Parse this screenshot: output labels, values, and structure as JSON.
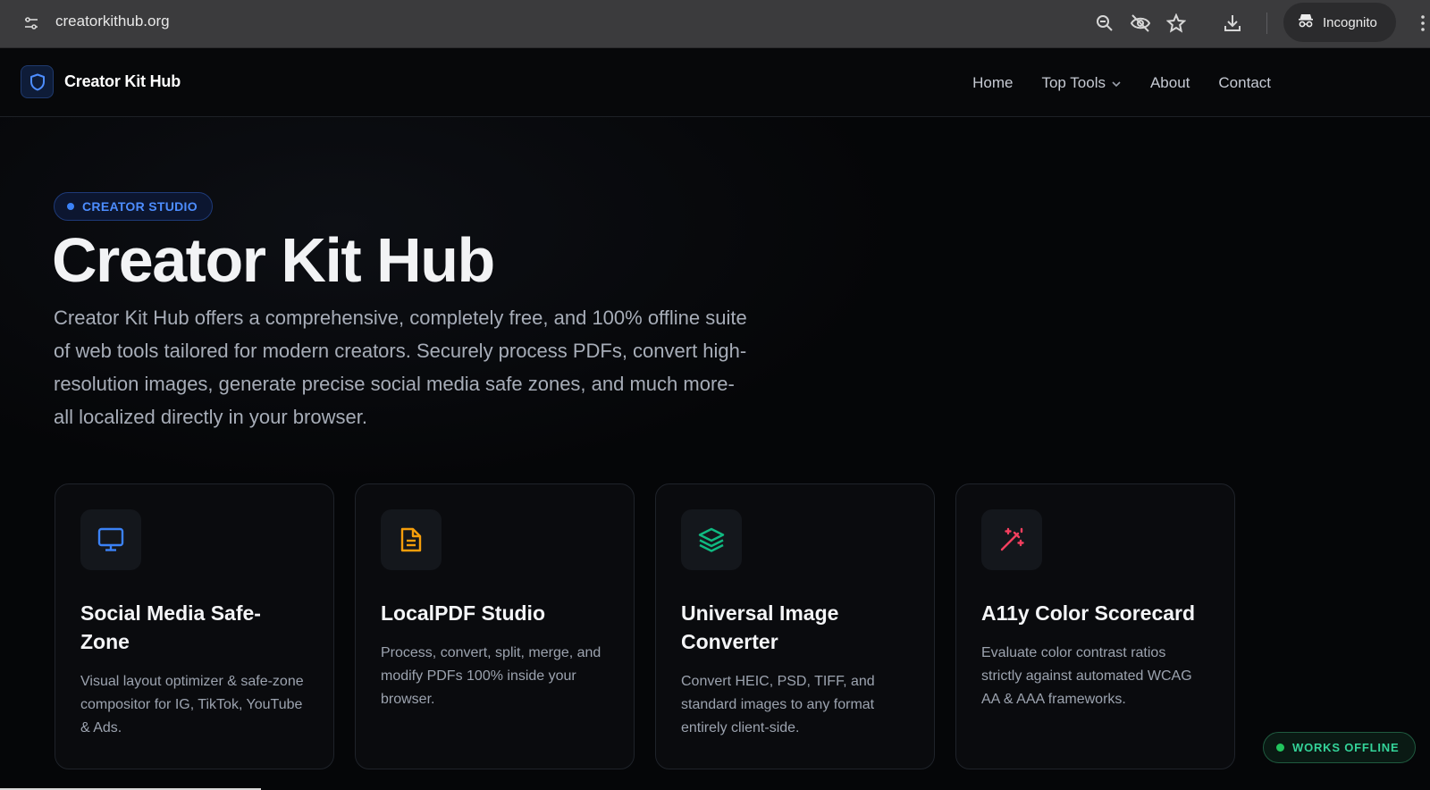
{
  "browser": {
    "url": "creatorkithub.org",
    "incognito_label": "Incognito",
    "icons": [
      "site-info-icon",
      "zoom-icon",
      "eye-off-icon",
      "star-icon",
      "download-icon",
      "incognito-icon",
      "menu-icon"
    ]
  },
  "nav": {
    "brand": "Creator Kit Hub",
    "links": [
      "Home",
      "Top Tools",
      "About",
      "Contact"
    ]
  },
  "hero": {
    "badge": "CREATOR STUDIO",
    "title": "Creator Kit Hub",
    "description": "Creator Kit Hub offers a comprehensive, completely free, and 100% offline suite of web tools tailored for modern creators. Securely process PDFs, convert high-resolution images, generate precise social media safe zones, and much more-all localized directly in your browser."
  },
  "cards": [
    {
      "title": "Social Media Safe-Zone",
      "description": "Visual layout optimizer & safe-zone compositor for IG, TikTok, YouTube & Ads.",
      "icon": "monitor-icon",
      "color": "#3b82f6"
    },
    {
      "title": "LocalPDF Studio",
      "description": "Process, convert, split, merge, and modify PDFs 100% inside your browser.",
      "icon": "document-icon",
      "color": "#f59e0b"
    },
    {
      "title": "Universal Image Converter",
      "description": "Convert HEIC, PSD, TIFF, and standard images to any format entirely client-side.",
      "icon": "layers-icon",
      "color": "#10b981"
    },
    {
      "title": "A11y Color Scorecard",
      "description": "Evaluate color contrast ratios strictly against automated WCAG AA & AAA frameworks.",
      "icon": "magic-wand-icon",
      "color": "#f43f5e"
    }
  ],
  "status_badge": "WORKS OFFLINE",
  "colors": {
    "accent": "#3b82f6",
    "offline": "#34d399",
    "background": "#050608"
  }
}
